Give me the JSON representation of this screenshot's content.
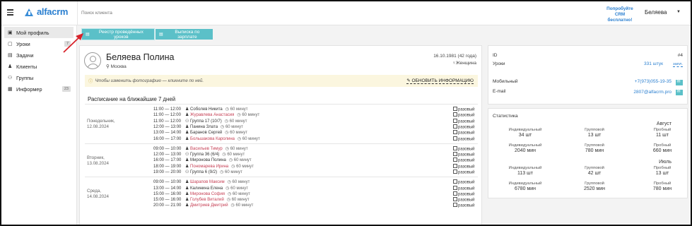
{
  "header": {
    "logo_text": "alfacrm",
    "search_placeholder": "Поиск клиента",
    "promo_line1": "Попробуйте",
    "promo_line2": "CRM бесплатно!",
    "user_name": "Беляева"
  },
  "sidebar": {
    "items": [
      {
        "label": "Мой профиль",
        "icon": "user-icon",
        "badge": ""
      },
      {
        "label": "Уроки",
        "icon": "calendar-icon",
        "badge": "7"
      },
      {
        "label": "Задачи",
        "icon": "tasks-icon",
        "badge": ""
      },
      {
        "label": "Клиенты",
        "icon": "clients-icon",
        "badge": ""
      },
      {
        "label": "Группы",
        "icon": "groups-icon",
        "badge": ""
      },
      {
        "label": "Информер",
        "icon": "informer-icon",
        "badge": "23"
      }
    ]
  },
  "toolbar": {
    "registry_label": "Реестр проведённых уроков",
    "salary_label": "Выписка по зарплате"
  },
  "profile": {
    "name": "Беляева Полина",
    "city": "Москва",
    "birth": "16.10.1981 (42 года)",
    "gender": "Женщина",
    "hint": "Чтобы изменить фотографию — кликните по ней.",
    "update_label": "ОБНОВИТЬ ИНФОРМАЦИЮ"
  },
  "schedule": {
    "title": "Расписание на ближайшие 7 дней",
    "days": [
      {
        "label": "Понедельник,",
        "date": "12.08.2024",
        "lessons": [
          {
            "time": "11:00 — 12:00",
            "who": "Соболев Никита",
            "red": false,
            "group": false,
            "dur": "60 минут",
            "once": "разовый"
          },
          {
            "time": "11:00 — 12:00",
            "who": "Журавлева Анастасия",
            "red": true,
            "group": false,
            "dur": "60 минут",
            "once": "разовый"
          },
          {
            "time": "11:00 — 12:00",
            "who": "Группа 17 (10/7)",
            "red": false,
            "group": true,
            "dur": "60 минут",
            "once": "разовый"
          },
          {
            "time": "12:00 — 13:00",
            "who": "Панина Злата",
            "red": false,
            "group": false,
            "dur": "60 минут",
            "once": "разовый"
          },
          {
            "time": "13:00 — 14:00",
            "who": "Баранов Сергей",
            "red": false,
            "group": false,
            "dur": "60 минут",
            "once": "разовый"
          },
          {
            "time": "16:00 — 17:00",
            "who": "Большакова Каролина",
            "red": true,
            "group": false,
            "dur": "60 минут",
            "once": "разовый"
          }
        ]
      },
      {
        "label": "Вторник,",
        "date": "13.08.2024",
        "lessons": [
          {
            "time": "09:00 — 10:00",
            "who": "Васильев Тимур",
            "red": true,
            "group": false,
            "dur": "60 минут",
            "once": "разовый"
          },
          {
            "time": "12:00 — 13:00",
            "who": "Группа 36 (6/4)",
            "red": false,
            "group": true,
            "dur": "60 минут",
            "once": "разовый"
          },
          {
            "time": "16:00 — 17:00",
            "who": "Миронова Полина",
            "red": false,
            "group": false,
            "dur": "60 минут",
            "once": "разовый"
          },
          {
            "time": "18:00 — 19:00",
            "who": "Пономарева Ирина",
            "red": true,
            "group": false,
            "dur": "60 минут",
            "once": "разовый"
          },
          {
            "time": "19:00 — 20:00",
            "who": "Группа 6 (9/2)",
            "red": false,
            "group": true,
            "dur": "60 минут",
            "once": "разовый"
          }
        ]
      },
      {
        "label": "Среда,",
        "date": "14.08.2024",
        "lessons": [
          {
            "time": "09:00 — 10:00",
            "who": "Шарапов Максим",
            "red": true,
            "group": false,
            "dur": "60 минут",
            "once": "разовый"
          },
          {
            "time": "13:00 — 14:00",
            "who": "Калинина Елена",
            "red": false,
            "group": false,
            "dur": "60 минут",
            "once": "разовый"
          },
          {
            "time": "15:00 — 16:00",
            "who": "Миронова София",
            "red": true,
            "group": false,
            "dur": "60 минут",
            "once": "разовый"
          },
          {
            "time": "15:00 — 16:00",
            "who": "Голубев Виталий",
            "red": true,
            "group": false,
            "dur": "60 минут",
            "once": "разовый"
          },
          {
            "time": "20:00 — 21:00",
            "who": "Дмитриев Дмитрий",
            "red": true,
            "group": false,
            "dur": "60 минут",
            "once": "разовый"
          }
        ]
      }
    ]
  },
  "info": {
    "id_label": "ID",
    "id_value": "#4",
    "lessons_label": "Уроки",
    "lessons_value": "331 штук",
    "lessons_link": "запл.",
    "mobile_label": "Мобильный",
    "mobile_value": "+7(973)055-19-35",
    "email_label": "E-mail",
    "email_value": "2807@alfacrm.pro"
  },
  "stats": {
    "title": "Статистика",
    "months": [
      {
        "name": "Август",
        "row1": [
          {
            "label": "Индивидуальный",
            "value": "34 шт"
          },
          {
            "label": "Групповой",
            "value": "13 шт"
          },
          {
            "label": "Пробный",
            "value": "11 шт"
          }
        ],
        "row2": [
          {
            "label": "Индивидуальный",
            "value": "2040 мин"
          },
          {
            "label": "Групповой",
            "value": "780 мин"
          },
          {
            "label": "Пробный",
            "value": "660 мин"
          }
        ]
      },
      {
        "name": "Июль",
        "row1": [
          {
            "label": "Индивидуальный",
            "value": "113 шт"
          },
          {
            "label": "Групповой",
            "value": "42 шт"
          },
          {
            "label": "Пробный",
            "value": "13 шт"
          }
        ],
        "row2": [
          {
            "label": "Индивидуальный",
            "value": "6780 мин"
          },
          {
            "label": "Групповой",
            "value": "2520 мин"
          },
          {
            "label": "Пробный",
            "value": "780 мин"
          }
        ]
      }
    ]
  }
}
